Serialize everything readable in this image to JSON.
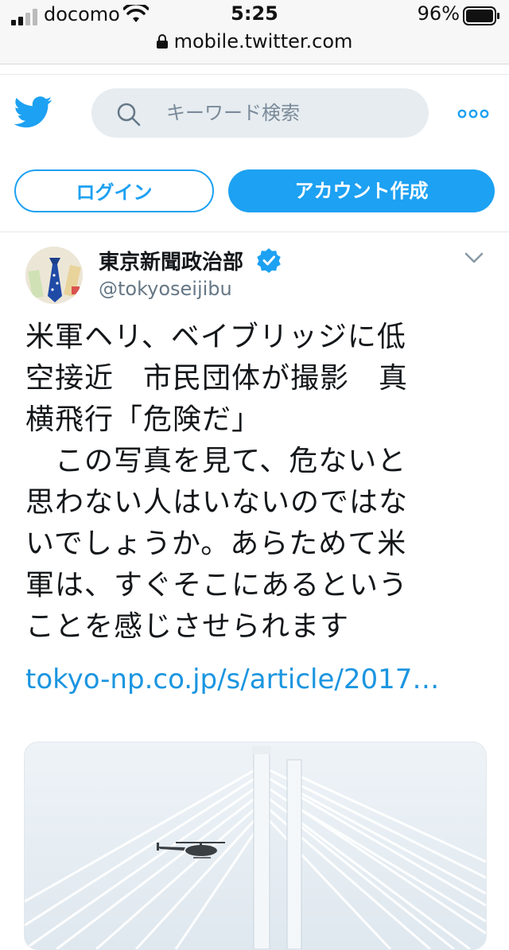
{
  "status_bar": {
    "carrier": "docomo",
    "time": "5:25",
    "battery": "96%",
    "url": "mobile.twitter.com"
  },
  "header": {
    "search_placeholder": "キーワード検索",
    "login_label": "ログイン",
    "signup_label": "アカウント作成"
  },
  "tweet": {
    "author_name": "東京新聞政治部",
    "author_handle": "@tokyoseijibu",
    "text_lines": [
      "米軍ヘリ、ベイブリッジに低",
      "空接近　市民団体が撮影　真",
      "横飛行「危険だ」",
      "　この写真を見て、危ないと",
      "思わない人はいないのではな",
      "いでしょうか。あらためて米",
      "軍は、すぐそこにあるという",
      "ことを感じさせられます"
    ],
    "link": "tokyo-np.co.jp/s/article/2017…"
  },
  "colors": {
    "twitter_blue": "#1da1f2",
    "link_blue": "#1b95e0",
    "handle_gray": "#657786"
  }
}
